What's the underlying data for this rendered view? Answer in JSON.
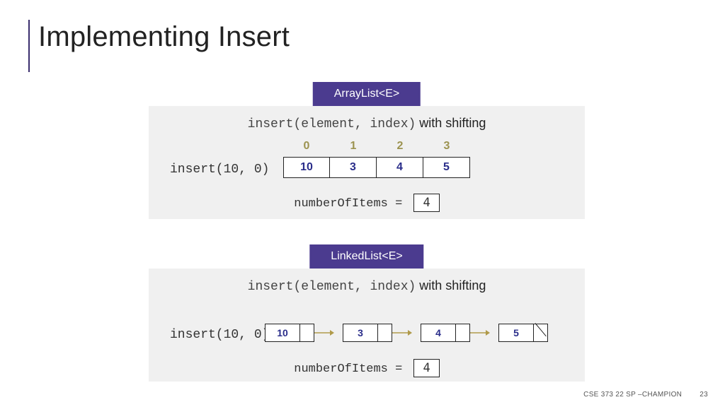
{
  "title": "Implementing Insert",
  "arraylist": {
    "badge": "ArrayList<E>",
    "signature_mono": "insert(element, index)",
    "signature_suffix": " with shifting",
    "call": "insert(10, 0)",
    "indices": [
      "0",
      "1",
      "2",
      "3"
    ],
    "cells": [
      "10",
      "3",
      "4",
      "5"
    ],
    "num_label": "numberOfItems = ",
    "num_value": "4"
  },
  "linkedlist": {
    "badge": "LinkedList<E>",
    "signature_mono": "insert(element, index)",
    "signature_suffix": " with shifting",
    "call": "insert(10, 0)",
    "nodes": [
      "10",
      "3",
      "4",
      "5"
    ],
    "num_label": "numberOfItems = ",
    "num_value": "4"
  },
  "footer": {
    "course": "CSE 373 22 SP –CHAMPION",
    "page": "23"
  }
}
